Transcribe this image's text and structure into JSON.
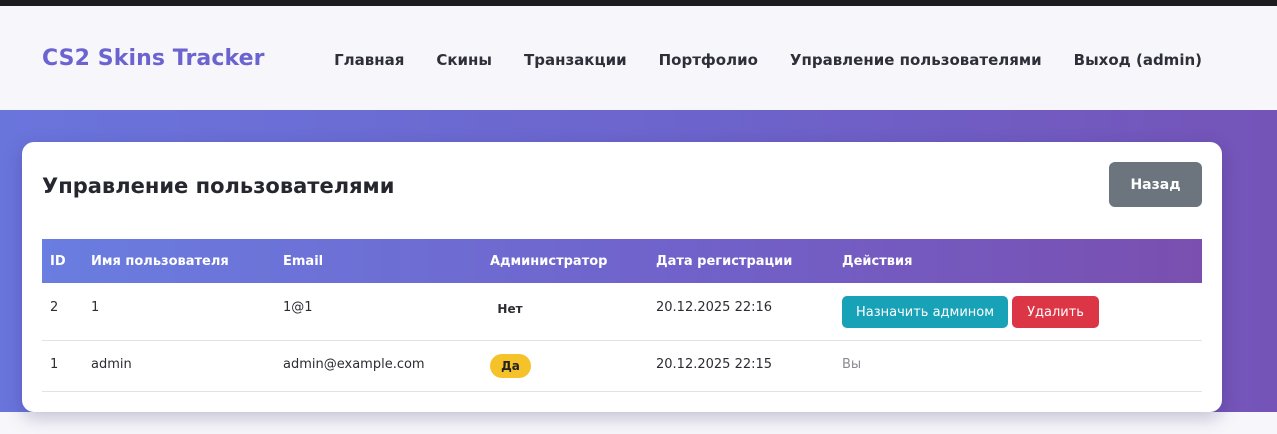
{
  "brand": "CS2 Skins Tracker",
  "nav": [
    "Главная",
    "Скины",
    "Транзакции",
    "Портфолио",
    "Управление пользователями",
    "Выход (admin)"
  ],
  "page": {
    "title": "Управление пользователями",
    "back_label": "Назад"
  },
  "table": {
    "headers": [
      "ID",
      "Имя пользователя",
      "Email",
      "Администратор",
      "Дата регистрации",
      "Действия"
    ],
    "rows": [
      {
        "id": "2",
        "username": "1",
        "email": "1@1",
        "admin": "Нет",
        "date": "20.12.2025 22:16",
        "actions": {
          "make_admin": "Назначить админом",
          "delete": "Удалить"
        }
      },
      {
        "id": "1",
        "username": "admin",
        "email": "admin@example.com",
        "admin": "Да",
        "date": "20.12.2025 22:15",
        "actions": {
          "self": "Вы"
        }
      }
    ]
  },
  "colors": {
    "brand": "#6b63d0",
    "back_button": "#6c757d",
    "make_admin_button": "#17a2b8",
    "delete_button": "#dc3545",
    "admin_yes_badge": "#f5c22a"
  }
}
